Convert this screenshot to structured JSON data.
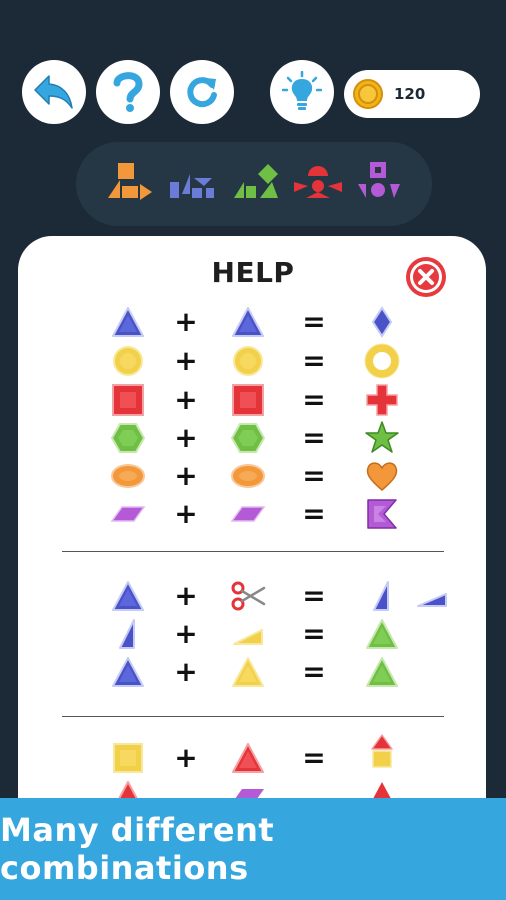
{
  "toolbar": {
    "buttons": [
      "back-icon",
      "help-icon",
      "restart-icon",
      "hint-icon"
    ],
    "coins": "120"
  },
  "strip": [
    "shape-group-1",
    "shape-group-2",
    "shape-group-3",
    "shape-group-4",
    "shape-group-5"
  ],
  "help": {
    "title": "HELP",
    "plus": "+",
    "equals": "="
  },
  "sections": [
    [
      {
        "a": "blue-triangle",
        "b": "blue-triangle",
        "r": [
          "blue-diamond"
        ]
      },
      {
        "a": "yellow-circle",
        "b": "yellow-circle",
        "r": [
          "yellow-ring"
        ]
      },
      {
        "a": "red-square",
        "b": "red-square",
        "r": [
          "red-cross"
        ]
      },
      {
        "a": "green-hexagon",
        "b": "green-hexagon",
        "r": [
          "green-star"
        ]
      },
      {
        "a": "orange-ellipse",
        "b": "orange-ellipse",
        "r": [
          "orange-heart"
        ]
      },
      {
        "a": "purple-parallelogram",
        "b": "purple-parallelogram",
        "r": [
          "purple-notch"
        ]
      }
    ],
    [
      {
        "a": "blue-triangle",
        "b": "scissors",
        "r": [
          "blue-half-triangle",
          "blue-half-triangle-flat"
        ]
      },
      {
        "a": "blue-half-triangle",
        "b": "yellow-half-triangle-flat",
        "r": [
          "green-triangle"
        ]
      },
      {
        "a": "blue-triangle",
        "b": "yellow-triangle",
        "r": [
          "green-triangle"
        ]
      }
    ],
    [
      {
        "a": "yellow-square",
        "b": "red-triangle",
        "r": [
          "red-house"
        ]
      }
    ]
  ],
  "colors": {
    "background": "#1b2a36",
    "banner": "#35a6de",
    "blue": "#4a52c8",
    "yellow": "#f3d04a",
    "red": "#e5333a",
    "green": "#6fbf45",
    "orange": "#f2973a",
    "purple": "#b45ad6",
    "accent": "#35a6de"
  },
  "banner": {
    "text": "Many different combinations"
  }
}
